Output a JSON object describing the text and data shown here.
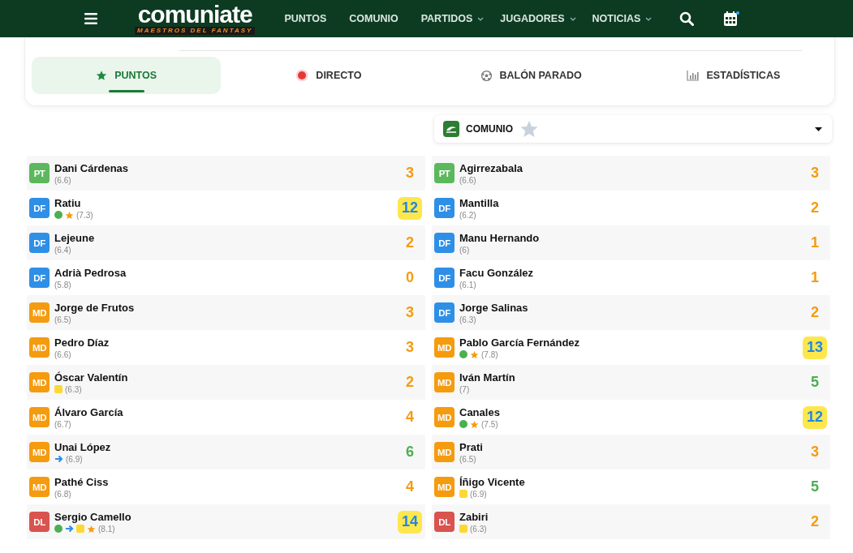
{
  "navbar": {
    "logo": {
      "title": "comuniate",
      "tagline": "MAESTROS DEL FANTASY"
    },
    "items": [
      {
        "label": "PUNTOS",
        "has_menu": false
      },
      {
        "label": "COMUNIO",
        "has_menu": false
      },
      {
        "label": "PARTIDOS",
        "has_menu": true
      },
      {
        "label": "JUGADORES",
        "has_menu": true
      },
      {
        "label": "NOTICIAS",
        "has_menu": true
      }
    ],
    "calendar_notification": true
  },
  "tabs": [
    {
      "label": "PUNTOS",
      "kind": "star",
      "selected": true
    },
    {
      "label": "DIRECTO",
      "kind": "live",
      "selected": false
    },
    {
      "label": "BALÓN PARADO",
      "kind": "ball",
      "selected": false
    },
    {
      "label": "ESTADÍSTICAS",
      "kind": "chart",
      "selected": false
    }
  ],
  "source_select": {
    "value": "COMUNIO",
    "favorite": false
  },
  "columns": [
    {
      "players": [
        {
          "position": "PT",
          "color": "#5cb85c",
          "name": "Dani Cárdenas",
          "rating": "(6.6)",
          "points": {
            "value": "3",
            "highlighted": false,
            "color": "#f59b0f"
          }
        },
        {
          "position": "DF",
          "color": "#2f8fe6",
          "name": "Ratiu",
          "events": [
            {
              "kind": "goal"
            },
            {
              "kind": "star"
            }
          ],
          "rating": "(7.3)",
          "points": {
            "value": "12",
            "highlighted": true
          }
        },
        {
          "position": "DF",
          "color": "#2f8fe6",
          "name": "Lejeune",
          "rating": "(6.4)",
          "points": {
            "value": "2",
            "highlighted": false,
            "color": "#f59b0f"
          }
        },
        {
          "position": "DF",
          "color": "#2f8fe6",
          "name": "Adrià Pedrosa",
          "rating": "(5.8)",
          "points": {
            "value": "0",
            "highlighted": false,
            "color": "#f59b0f"
          }
        },
        {
          "position": "MD",
          "color": "#f59b0f",
          "name": "Jorge de Frutos",
          "rating": "(6.5)",
          "points": {
            "value": "3",
            "highlighted": false,
            "color": "#f59b0f"
          }
        },
        {
          "position": "MD",
          "color": "#f59b0f",
          "name": "Pedro Díaz",
          "rating": "(6.6)",
          "points": {
            "value": "3",
            "highlighted": false,
            "color": "#f59b0f"
          }
        },
        {
          "position": "MD",
          "color": "#f59b0f",
          "name": "Óscar Valentín",
          "events": [
            {
              "kind": "card"
            }
          ],
          "rating": "(6.3)",
          "points": {
            "value": "2",
            "highlighted": false,
            "color": "#f59b0f"
          }
        },
        {
          "position": "MD",
          "color": "#f59b0f",
          "name": "Álvaro García",
          "rating": "(6.7)",
          "points": {
            "value": "4",
            "highlighted": false,
            "color": "#f59b0f"
          }
        },
        {
          "position": "MD",
          "color": "#f59b0f",
          "name": "Unai López",
          "events": [
            {
              "kind": "assist"
            }
          ],
          "rating": "(6.9)",
          "points": {
            "value": "6",
            "highlighted": false,
            "color": "#4caf50"
          }
        },
        {
          "position": "MD",
          "color": "#f59b0f",
          "name": "Pathé Ciss",
          "rating": "(6.8)",
          "points": {
            "value": "4",
            "highlighted": false,
            "color": "#f59b0f"
          }
        },
        {
          "position": "DL",
          "color": "#d9534f",
          "name": "Sergio Camello",
          "events": [
            {
              "kind": "goal"
            },
            {
              "kind": "assist"
            },
            {
              "kind": "card"
            },
            {
              "kind": "star"
            }
          ],
          "rating": "(8.1)",
          "points": {
            "value": "14",
            "highlighted": true
          }
        }
      ]
    },
    {
      "players": [
        {
          "position": "PT",
          "color": "#5cb85c",
          "name": "Agirrezabala",
          "rating": "(6.6)",
          "points": {
            "value": "3",
            "highlighted": false,
            "color": "#f59b0f"
          }
        },
        {
          "position": "DF",
          "color": "#2f8fe6",
          "name": "Mantilla",
          "rating": "(6.2)",
          "points": {
            "value": "2",
            "highlighted": false,
            "color": "#f59b0f"
          }
        },
        {
          "position": "DF",
          "color": "#2f8fe6",
          "name": "Manu Hernando",
          "rating": "(6)",
          "points": {
            "value": "1",
            "highlighted": false,
            "color": "#f59b0f"
          }
        },
        {
          "position": "DF",
          "color": "#2f8fe6",
          "name": "Facu González",
          "rating": "(6.1)",
          "points": {
            "value": "1",
            "highlighted": false,
            "color": "#f59b0f"
          }
        },
        {
          "position": "DF",
          "color": "#2f8fe6",
          "name": "Jorge Salinas",
          "rating": "(6.3)",
          "points": {
            "value": "2",
            "highlighted": false,
            "color": "#f59b0f"
          }
        },
        {
          "position": "MD",
          "color": "#f59b0f",
          "name": "Pablo García Fernández",
          "events": [
            {
              "kind": "goal"
            },
            {
              "kind": "star"
            }
          ],
          "rating": "(7.8)",
          "points": {
            "value": "13",
            "highlighted": true
          }
        },
        {
          "position": "MD",
          "color": "#f59b0f",
          "name": "Iván Martín",
          "rating": "(7)",
          "points": {
            "value": "5",
            "highlighted": false,
            "color": "#4caf50"
          }
        },
        {
          "position": "MD",
          "color": "#f59b0f",
          "name": "Canales",
          "events": [
            {
              "kind": "goal"
            },
            {
              "kind": "star"
            }
          ],
          "rating": "(7.5)",
          "points": {
            "value": "12",
            "highlighted": true
          }
        },
        {
          "position": "MD",
          "color": "#f59b0f",
          "name": "Prati",
          "rating": "(6.5)",
          "points": {
            "value": "3",
            "highlighted": false,
            "color": "#f59b0f"
          }
        },
        {
          "position": "MD",
          "color": "#f59b0f",
          "name": "Íñigo Vicente",
          "events": [
            {
              "kind": "card"
            }
          ],
          "rating": "(6.9)",
          "points": {
            "value": "5",
            "highlighted": false,
            "color": "#4caf50"
          }
        },
        {
          "position": "DL",
          "color": "#d9534f",
          "name": "Zabiri",
          "events": [
            {
              "kind": "card"
            }
          ],
          "rating": "(6.3)",
          "points": {
            "value": "2",
            "highlighted": false,
            "color": "#f59b0f"
          }
        }
      ]
    }
  ]
}
